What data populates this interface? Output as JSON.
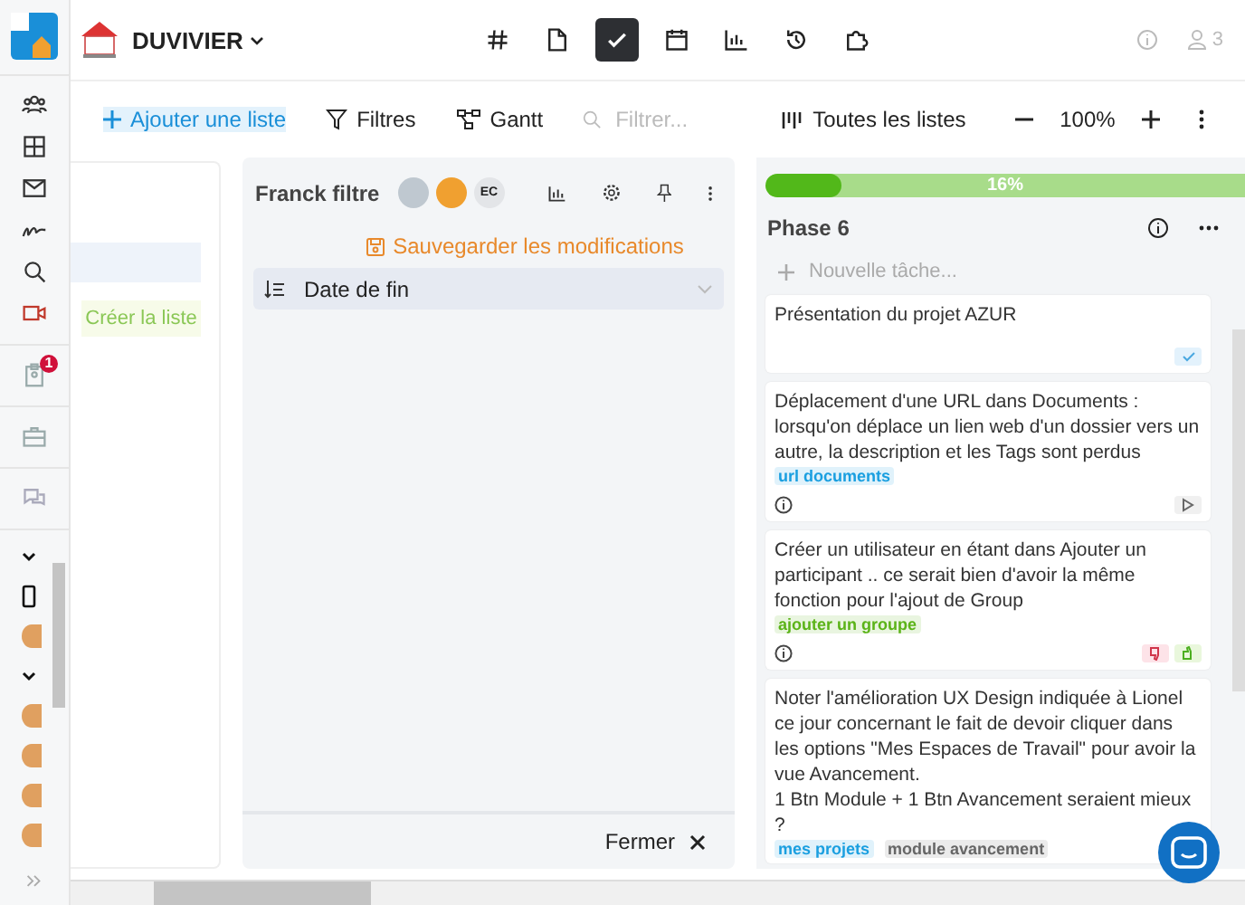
{
  "header": {
    "workspace": "DUVIVIER",
    "user_count": "3",
    "nav": [
      {
        "kind": "hash",
        "selected": false
      },
      {
        "kind": "document",
        "selected": false
      },
      {
        "kind": "check",
        "selected": true
      },
      {
        "kind": "calendar",
        "selected": false
      },
      {
        "kind": "chart",
        "selected": false
      },
      {
        "kind": "history",
        "selected": false
      },
      {
        "kind": "puzzle",
        "selected": false
      }
    ]
  },
  "sidebar": {
    "groups": [
      [
        {
          "kind": "people"
        },
        {
          "kind": "grid"
        },
        {
          "kind": "mail"
        },
        {
          "kind": "signature"
        },
        {
          "kind": "search"
        },
        {
          "kind": "video"
        }
      ],
      [
        {
          "kind": "clipboard",
          "badge": "1"
        }
      ],
      [
        {
          "kind": "briefcase"
        }
      ],
      [
        {
          "kind": "chat"
        }
      ]
    ],
    "list": [
      {
        "kind": "chevron"
      },
      {
        "kind": "device"
      },
      {
        "kind": "avatar"
      },
      {
        "kind": "chevron"
      },
      {
        "kind": "avatar"
      },
      {
        "kind": "avatar"
      },
      {
        "kind": "avatar"
      },
      {
        "kind": "avatar"
      }
    ]
  },
  "toolbar": {
    "add_list": "Ajouter une liste",
    "filters": "Filtres",
    "gantt": "Gantt",
    "search": {
      "placeholder": "Filtrer..."
    },
    "all_lists": "Toutes les listes",
    "zoom": "100%"
  },
  "left_panel": {
    "create_list": "Créer la liste"
  },
  "filter_column": {
    "title": "Franck filtre",
    "members": [
      {
        "kind": "photo"
      },
      {
        "kind": "photo"
      },
      {
        "kind": "initials",
        "label": "EC"
      }
    ],
    "save": "Sauvegarder les modifications",
    "sort": "Date de fin",
    "close": "Fermer"
  },
  "phase": {
    "progress": {
      "level": 0.16,
      "label": "16%"
    },
    "title": "Phase 6",
    "new_task": {
      "placeholder": "Nouvelle tâche..."
    },
    "cards": [
      {
        "text": "Présentation du projet AZUR",
        "indicators": [
          {
            "kind": "done"
          }
        ]
      },
      {
        "text": "Déplacement d'une URL dans Documents : lorsqu'on déplace un lien web d'un dossier vers un autre, la description et les Tags sont perdus",
        "tags": [
          {
            "label": "url documents",
            "color": "#1a9fe0"
          }
        ],
        "indicators": [
          {
            "kind": "info"
          },
          {
            "kind": "play"
          }
        ]
      },
      {
        "text": "Créer un utilisateur en étant dans Ajouter un participant .. ce serait bien d'avoir la même fonction pour l'ajout de Group",
        "tags": [
          {
            "label": "ajouter un groupe",
            "color": "#5bb318"
          }
        ],
        "indicators": [
          {
            "kind": "info"
          },
          {
            "kind": "thumbs-down"
          },
          {
            "kind": "thumbs-up"
          }
        ]
      },
      {
        "text": "Noter l'amélioration UX Design indiquée à Lionel ce jour concernant le fait de devoir cliquer dans les options \"Mes Espaces de Travail\" pour avoir la vue Avancement.\n1 Btn Module + 1 Btn Avancement seraient mieux ?",
        "tags": [
          {
            "label": "mes projets",
            "color": "#1a9fe0"
          },
          {
            "label": "module avancement",
            "color": "#666666"
          }
        ]
      }
    ]
  }
}
